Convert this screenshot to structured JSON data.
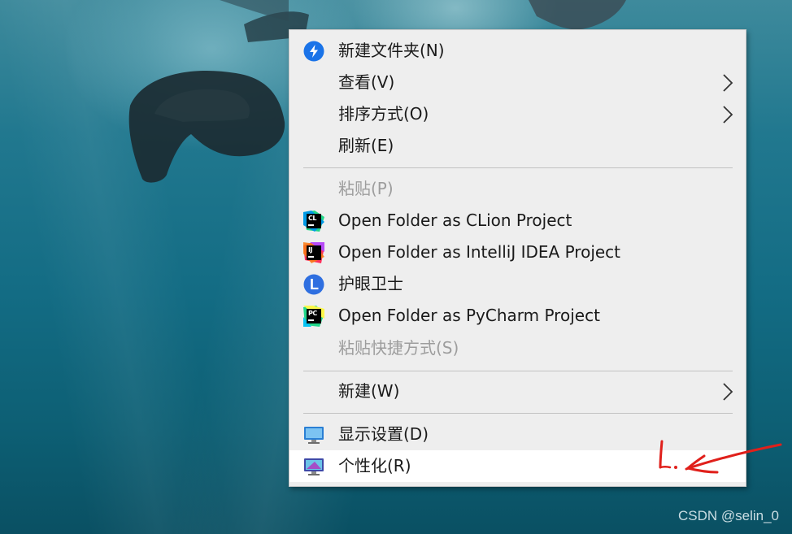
{
  "menu": {
    "items": [
      {
        "label": "新建文件夹(N)",
        "icon": "new-folder-icon",
        "enabled": true
      },
      {
        "label": "查看(V)",
        "submenu": true,
        "enabled": true
      },
      {
        "label": "排序方式(O)",
        "submenu": true,
        "enabled": true
      },
      {
        "label": "刷新(E)",
        "enabled": true
      },
      {
        "label": "粘贴(P)",
        "enabled": false
      },
      {
        "label": "Open Folder as CLion Project",
        "icon": "clion-icon",
        "icon_text": "CL",
        "enabled": true
      },
      {
        "label": "Open Folder as IntelliJ IDEA Project",
        "icon": "intellij-idea-icon",
        "icon_text": "IJ",
        "enabled": true
      },
      {
        "label": "护眼卫士",
        "icon": "eye-guard-icon",
        "icon_text": "L",
        "enabled": true
      },
      {
        "label": "Open Folder as PyCharm Project",
        "icon": "pycharm-icon",
        "icon_text": "PC",
        "enabled": true
      },
      {
        "label": "粘贴快捷方式(S)",
        "enabled": false
      },
      {
        "label": "新建(W)",
        "submenu": true,
        "enabled": true
      },
      {
        "label": "显示设置(D)",
        "icon": "display-settings-icon",
        "enabled": true
      },
      {
        "label": "个性化(R)",
        "icon": "personalize-icon",
        "enabled": true,
        "highlighted": true
      }
    ]
  },
  "annotation": {
    "text": "1."
  },
  "watermark": "CSDN @selin_0",
  "colors": {
    "menu_bg": "#eeeeee",
    "hover_bg": "#ffffff",
    "disabled_text": "#9d9d9d",
    "annotation_red": "#e0201b"
  }
}
